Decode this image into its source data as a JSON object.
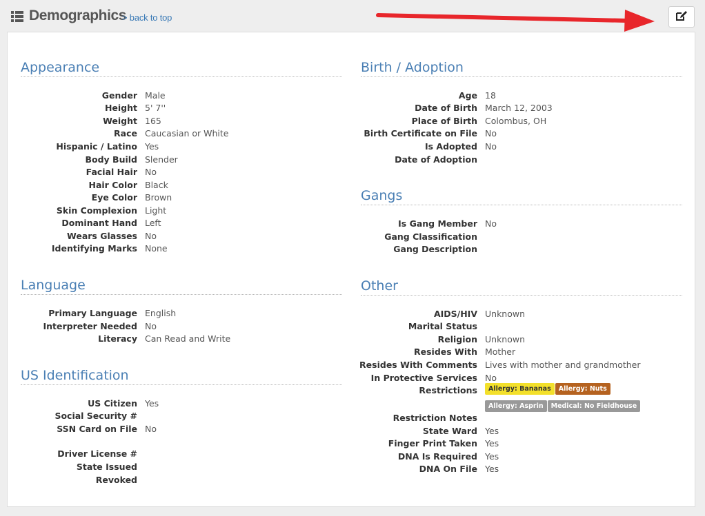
{
  "header": {
    "title": "Demographics",
    "back_link": "> back to top"
  },
  "colors": {
    "accent": "#4a7fb4",
    "arrow": "#e8262b",
    "badge_yellow": "#f3e02b",
    "badge_orange": "#b5621f",
    "badge_gray": "#999999"
  },
  "icons": {
    "header": "list-icon",
    "edit": "edit-icon"
  },
  "appearance": {
    "title": "Appearance",
    "rows": [
      {
        "label": "Gender",
        "value": "Male"
      },
      {
        "label": "Height",
        "value": "5' 7''"
      },
      {
        "label": "Weight",
        "value": "165"
      },
      {
        "label": "Race",
        "value": "Caucasian or White"
      },
      {
        "label": "Hispanic / Latino",
        "value": "Yes"
      },
      {
        "label": "Body Build",
        "value": "Slender"
      },
      {
        "label": "Facial Hair",
        "value": "No"
      },
      {
        "label": "Hair Color",
        "value": "Black"
      },
      {
        "label": "Eye Color",
        "value": "Brown"
      },
      {
        "label": "Skin Complexion",
        "value": "Light"
      },
      {
        "label": "Dominant Hand",
        "value": "Left"
      },
      {
        "label": "Wears Glasses",
        "value": "No"
      },
      {
        "label": "Identifying Marks",
        "value": "None"
      }
    ]
  },
  "language": {
    "title": "Language",
    "rows": [
      {
        "label": "Primary Language",
        "value": "English"
      },
      {
        "label": "Interpreter Needed",
        "value": "No"
      },
      {
        "label": "Literacy",
        "value": "Can Read and Write"
      }
    ]
  },
  "us_identification": {
    "title": "US Identification",
    "rows": [
      {
        "label": "US Citizen",
        "value": "Yes"
      },
      {
        "label": "Social Security #",
        "value": ""
      },
      {
        "label": "SSN Card on File",
        "value": "No"
      },
      {
        "label": "Driver License #",
        "value": ""
      },
      {
        "label": "State Issued",
        "value": ""
      },
      {
        "label": "Revoked",
        "value": ""
      }
    ]
  },
  "birth": {
    "title": "Birth / Adoption",
    "rows": [
      {
        "label": "Age",
        "value": "18"
      },
      {
        "label": "Date of Birth",
        "value": "March 12, 2003"
      },
      {
        "label": "Place of Birth",
        "value": "Colombus, OH"
      },
      {
        "label": "Birth Certificate on File",
        "value": "No"
      },
      {
        "label": "Is Adopted",
        "value": "No"
      },
      {
        "label": "Date of Adoption",
        "value": ""
      }
    ]
  },
  "gangs": {
    "title": "Gangs",
    "rows": [
      {
        "label": "Is Gang Member",
        "value": "No"
      },
      {
        "label": "Gang Classification",
        "value": ""
      },
      {
        "label": "Gang Description",
        "value": ""
      }
    ]
  },
  "other": {
    "title": "Other",
    "rows": [
      {
        "label": "AIDS/HIV",
        "value": "Unknown"
      },
      {
        "label": "Marital Status",
        "value": ""
      },
      {
        "label": "Religion",
        "value": "Unknown"
      },
      {
        "label": "Resides With",
        "value": "Mother"
      },
      {
        "label": "Resides With Comments",
        "value": "Lives with mother and grandmother"
      },
      {
        "label": "In Protective Services",
        "value": "No"
      },
      {
        "label": "Restrictions",
        "value": ""
      },
      {
        "label": "Restriction Notes",
        "value": ""
      },
      {
        "label": "State Ward",
        "value": "Yes"
      },
      {
        "label": "Finger Print Taken",
        "value": "Yes"
      },
      {
        "label": "DNA Is Required",
        "value": "Yes"
      },
      {
        "label": "DNA On File",
        "value": "Yes"
      }
    ],
    "restrictions": [
      {
        "label": "Allergy: Bananas",
        "color": "yellow"
      },
      {
        "label": "Allergy: Nuts",
        "color": "orange"
      },
      {
        "label": "Allergy: Asprin",
        "color": "gray"
      },
      {
        "label": "Medical: No Fieldhouse",
        "color": "gray"
      }
    ]
  }
}
